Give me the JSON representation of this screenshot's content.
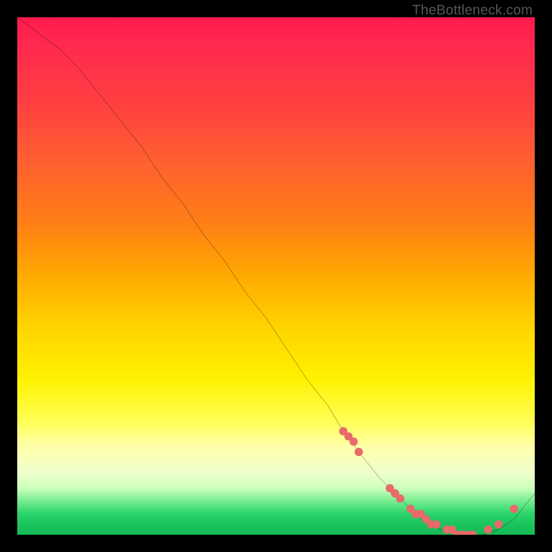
{
  "watermark": "TheBottleneck.com",
  "chart_data": {
    "type": "line",
    "title": "",
    "xlabel": "",
    "ylabel": "",
    "xlim": [
      0,
      100
    ],
    "ylim": [
      0,
      100
    ],
    "curve": {
      "name": "bottleneck-curve",
      "x": [
        0,
        4,
        8,
        12,
        16,
        20,
        24,
        28,
        32,
        36,
        40,
        44,
        48,
        52,
        56,
        60,
        63,
        66,
        70,
        74,
        78,
        82,
        86,
        90,
        93,
        96,
        100
      ],
      "y": [
        100,
        97,
        94,
        90,
        85,
        80,
        75,
        69,
        64,
        58,
        53,
        47,
        42,
        36,
        30,
        25,
        20,
        16,
        11,
        7,
        3,
        1,
        0,
        0,
        1,
        3,
        8
      ]
    },
    "points": {
      "name": "highlight-points",
      "color": "#e86a6a",
      "x": [
        63,
        64,
        65,
        66,
        72,
        73,
        74,
        76,
        77,
        78,
        79,
        80,
        81,
        83,
        84,
        85,
        86,
        87,
        88,
        91,
        93,
        96
      ],
      "y": [
        20,
        19,
        18,
        16,
        9,
        8,
        7,
        5,
        4,
        4,
        3,
        2,
        2,
        1,
        1,
        0,
        0,
        0,
        0,
        1,
        2,
        5
      ]
    }
  }
}
